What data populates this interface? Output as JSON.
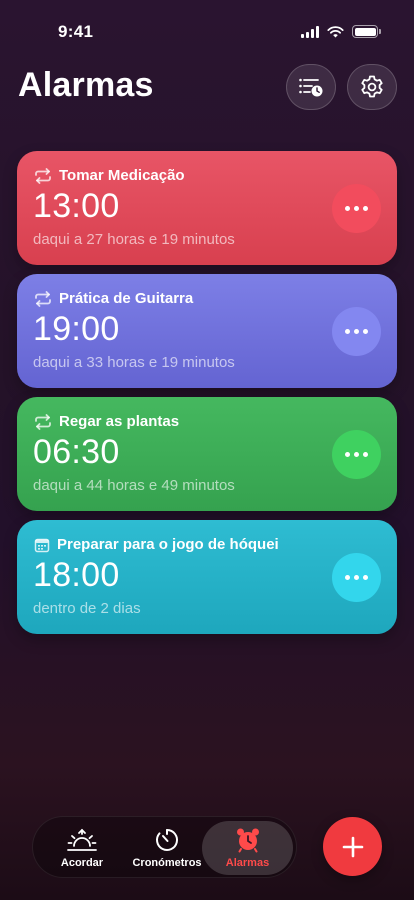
{
  "status": {
    "time": "9:41"
  },
  "header": {
    "title": "Alarmas"
  },
  "alarms": [
    {
      "label": "Tomar Medicação",
      "time": "13:00",
      "subtitle": "daqui a 27 horas e 19 minutos",
      "icon": "repeat-icon",
      "color": "#e0485a",
      "button_color": "#f0475a"
    },
    {
      "label": "Prática de Guitarra",
      "time": "19:00",
      "subtitle": "daqui a 33 horas e 19 minutos",
      "icon": "repeat-icon",
      "color": "#6f6fdc",
      "button_color": "#7c80ee"
    },
    {
      "label": "Regar as plantas",
      "time": "06:30",
      "subtitle": "daqui a 44 horas e 49 minutos",
      "icon": "repeat-icon",
      "color": "#3aaa55",
      "button_color": "#3ccf5c"
    },
    {
      "label": "Preparar para o jogo de hóquei",
      "time": "18:00",
      "subtitle": "dentro de 2 dias",
      "icon": "calendar-icon",
      "color": "#22aec4",
      "button_color": "#2ed3ea"
    }
  ],
  "tabs": [
    {
      "label": "Acordar",
      "icon": "sunrise-icon"
    },
    {
      "label": "Cronómetros",
      "icon": "timer-icon"
    },
    {
      "label": "Alarmas",
      "icon": "alarm-clock-icon",
      "active": true
    }
  ],
  "colors": {
    "accent": "#f03a3f",
    "active_tab": "#ff4a4a"
  }
}
